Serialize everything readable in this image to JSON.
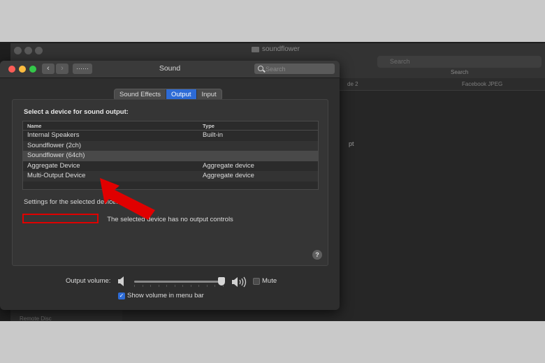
{
  "finder": {
    "title": "soundflower",
    "search_placeholder": "Search",
    "search_label": "Search",
    "columns": [
      "de 2",
      "Facebook JPEG"
    ],
    "fragment_text": "pt",
    "sidebar_bottom": "Remote Disc"
  },
  "window": {
    "title": "Sound",
    "search_placeholder": "Search"
  },
  "tabs": [
    {
      "label": "Sound Effects",
      "active": false
    },
    {
      "label": "Output",
      "active": true
    },
    {
      "label": "Input",
      "active": false
    }
  ],
  "output": {
    "select_label": "Select a device for sound output:",
    "columns": {
      "name": "Name",
      "type": "Type"
    },
    "devices": [
      {
        "name": "Internal Speakers",
        "type": "Built-in"
      },
      {
        "name": "Soundflower (2ch)",
        "type": ""
      },
      {
        "name": "Soundflower (64ch)",
        "type": ""
      },
      {
        "name": "Aggregate Device",
        "type": "Aggregate device"
      },
      {
        "name": "Multi-Output Device",
        "type": "Aggregate device"
      }
    ],
    "selected_index": 2,
    "settings_label": "Settings for the selected device:",
    "no_controls_text": "The selected device has no output controls",
    "help_label": "?"
  },
  "volume": {
    "label": "Output volume:",
    "level": 0.98,
    "mute_label": "Mute",
    "mute_checked": false,
    "show_in_menu_bar_label": "Show volume in menu bar",
    "show_in_menu_bar_checked": true
  },
  "colors": {
    "accent": "#2d6bd6",
    "annotation": "#e00000"
  }
}
